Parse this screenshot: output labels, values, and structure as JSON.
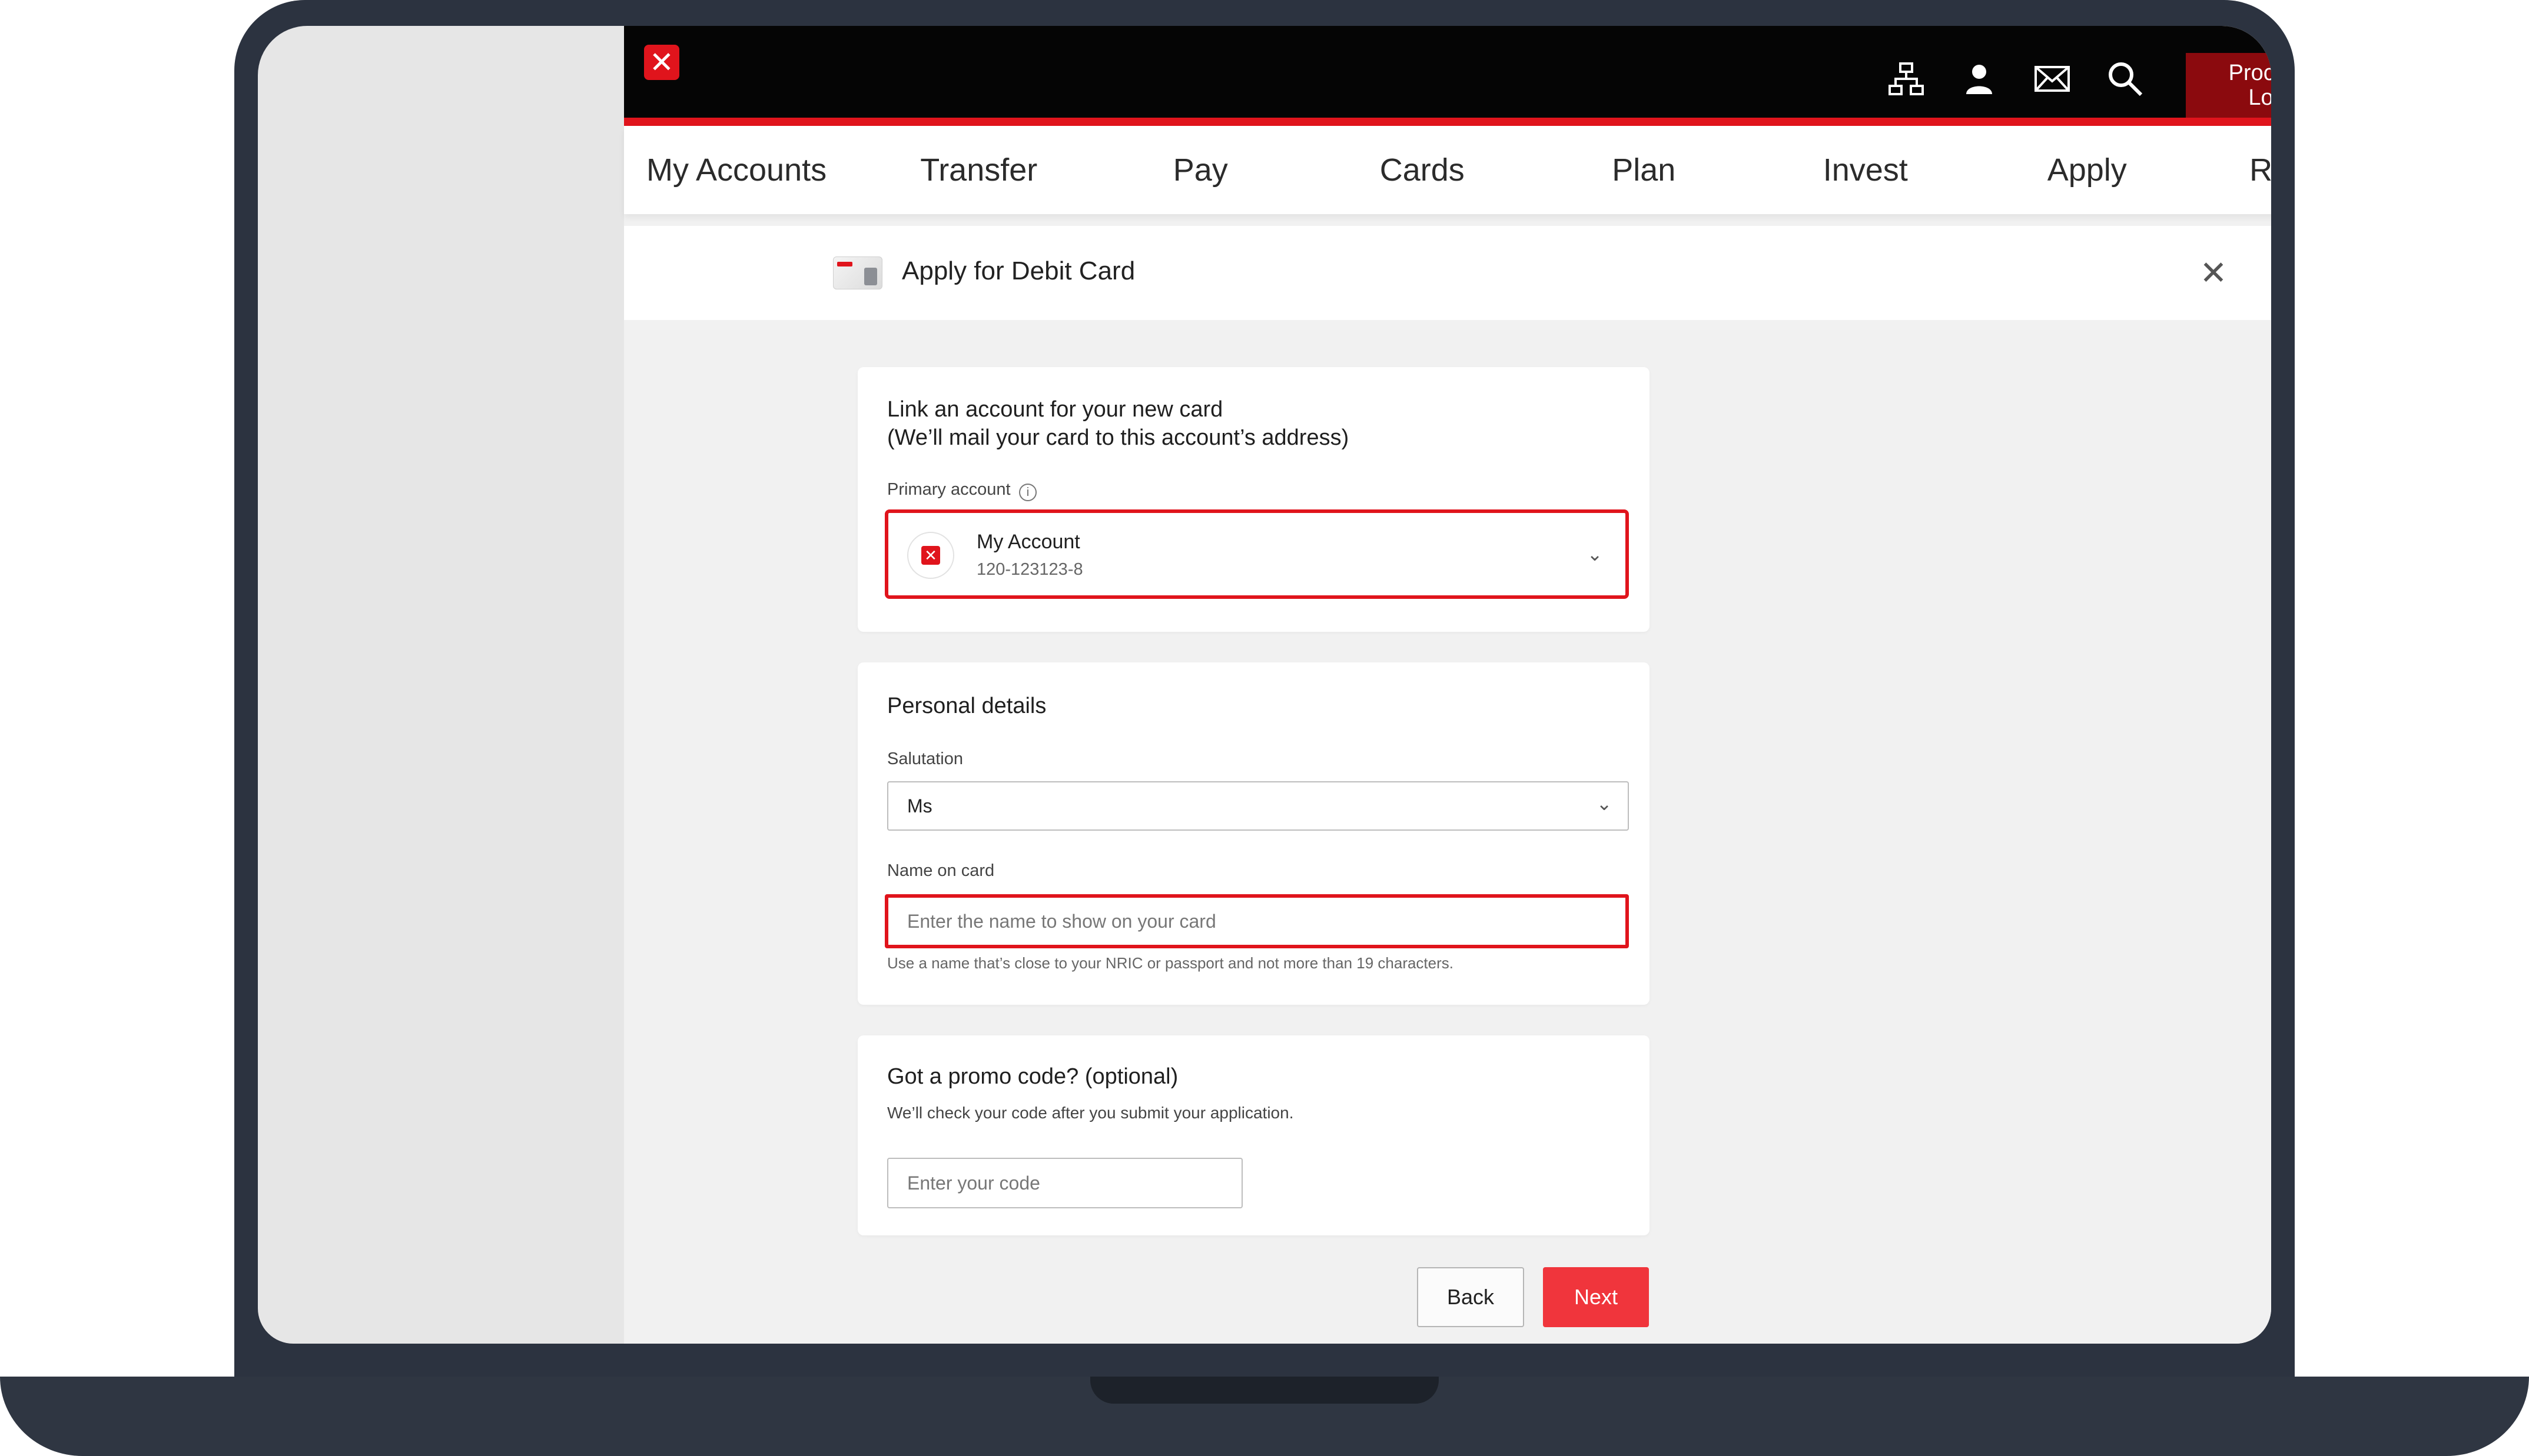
{
  "header": {
    "logout_line1": "Proceed to",
    "logout_line2": "Logout",
    "icons": [
      "sitemap-icon",
      "user-icon",
      "mail-icon",
      "search-icon",
      "logout-icon"
    ]
  },
  "nav": {
    "items": [
      "My Accounts",
      "Transfer",
      "Pay",
      "Cards",
      "Plan",
      "Invest",
      "Apply",
      "Request"
    ]
  },
  "page": {
    "title": "Apply for Debit Card"
  },
  "link_account": {
    "heading_line1": "Link an account for your new card",
    "heading_line2": "(We’ll mail your card to this account’s address)",
    "primary_label": "Primary account",
    "account_name": "My Account",
    "account_number": "120-123123-8"
  },
  "personal": {
    "heading": "Personal details",
    "salutation_label": "Salutation",
    "salutation_value": "Ms",
    "name_label": "Name on card",
    "name_placeholder": "Enter the name to show on your card",
    "name_hint": "Use a name that’s close to your NRIC or passport and not more than 19 characters."
  },
  "promo": {
    "heading": "Got a promo code? (optional)",
    "subtext": "We’ll check your code after you submit your application.",
    "placeholder": "Enter your code"
  },
  "actions": {
    "back": "Back",
    "next": "Next"
  },
  "colors": {
    "brand_red": "#e0141c",
    "logout_bg": "#8b0a0e",
    "next_button": "#f0353c"
  }
}
